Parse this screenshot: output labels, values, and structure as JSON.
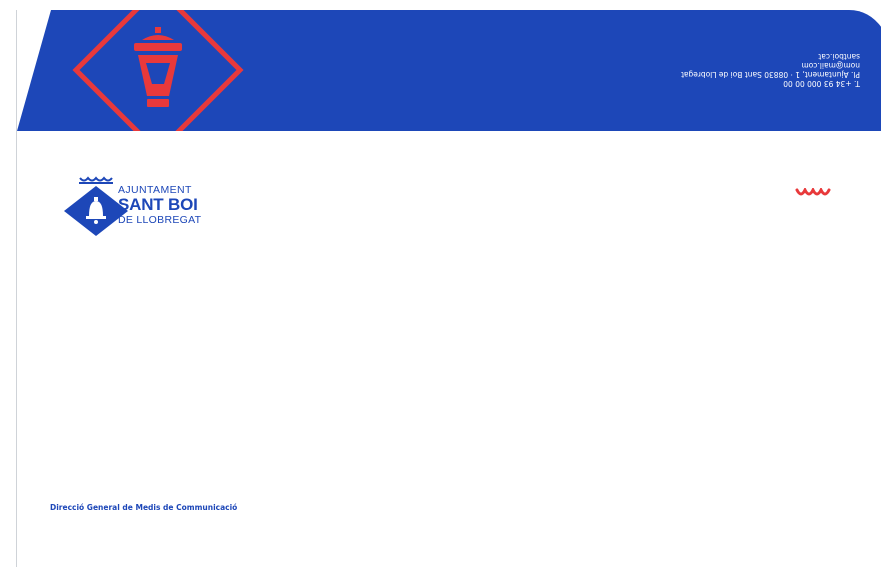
{
  "brand": {
    "blue": "#1d47b8",
    "red": "#e8393b",
    "flap_icon": "lantern-icon",
    "logo_icon": "bell-icon"
  },
  "flap": {
    "phone": "T. +34 93 000 00 00",
    "address": "Pl. Ajuntament, 1 · 08830 Sant Boi de Llobregat",
    "email": "nom@mail.com",
    "website": "santboi.cat"
  },
  "logo": {
    "line1": "AJUNTAMENT",
    "line2": "SANT BOI",
    "line3": "DE LLOBREGAT"
  },
  "department": "Direcció General de Medis de Communicació"
}
